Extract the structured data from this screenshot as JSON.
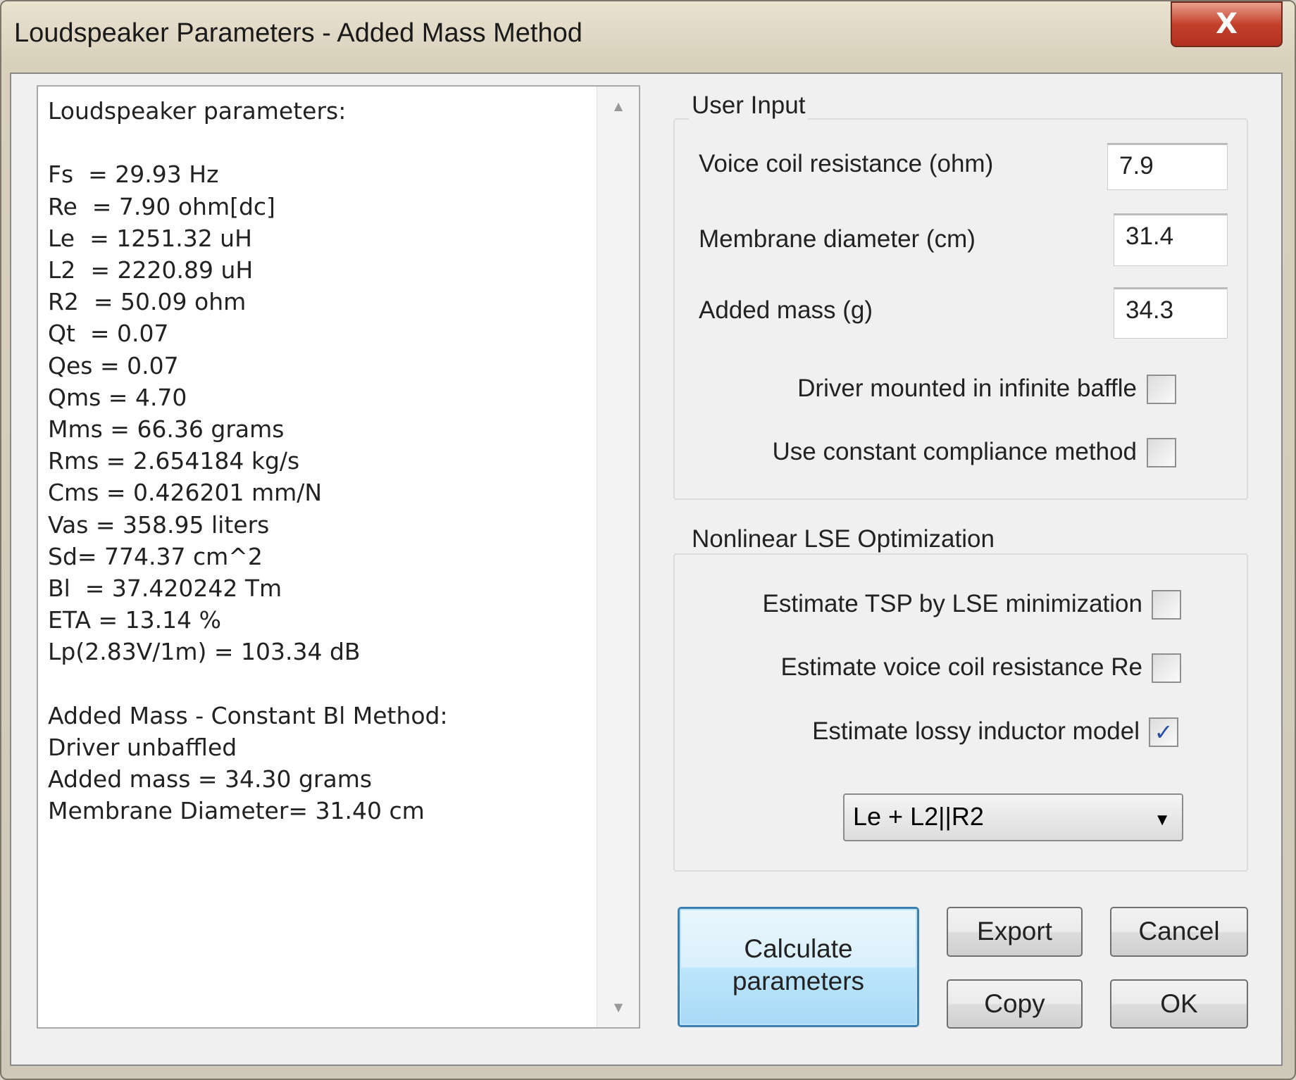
{
  "window": {
    "title": "Loudspeaker Parameters - Added Mass Method",
    "close_label": "X"
  },
  "results": {
    "lines": [
      "Loudspeaker parameters:",
      "",
      "Fs  = 29.93 Hz",
      "Re  = 7.90 ohm[dc]",
      "Le  = 1251.32 uH",
      "L2  = 2220.89 uH",
      "R2  = 50.09 ohm",
      "Qt  = 0.07",
      "Qes = 0.07",
      "Qms = 4.70",
      "Mms = 66.36 grams",
      "Rms = 2.654184 kg/s",
      "Cms = 0.426201 mm/N",
      "Vas = 358.95 liters",
      "Sd= 774.37 cm^2",
      "Bl  = 37.420242 Tm",
      "ETA = 13.14 %",
      "Lp(2.83V/1m) = 103.34 dB",
      "",
      "Added Mass - Constant Bl Method:",
      "Driver unbaffled",
      "Added mass = 34.30 grams",
      "Membrane Diameter= 31.40 cm"
    ]
  },
  "user_input": {
    "title": "User Input",
    "voice_coil_label": "Voice coil resistance (ohm)",
    "voice_coil_value": "7.9",
    "diameter_label": "Membrane diameter (cm)",
    "diameter_value": "31.4",
    "mass_label": "Added mass (g)",
    "mass_value": "34.3",
    "infinite_baffle_label": "Driver mounted in infinite baffle",
    "infinite_baffle_checked": false,
    "constant_compliance_label": "Use constant compliance method",
    "constant_compliance_checked": false
  },
  "lse": {
    "title": "Nonlinear LSE Optimization",
    "tsp_label": "Estimate TSP by LSE minimization",
    "tsp_checked": false,
    "re_label": "Estimate voice coil resistance Re",
    "re_checked": false,
    "lossy_label": "Estimate lossy inductor model",
    "lossy_checked": true,
    "model_selected": "Le + L2||R2"
  },
  "buttons": {
    "calculate": "Calculate\nparameters",
    "export": "Export",
    "cancel": "Cancel",
    "copy": "Copy",
    "ok": "OK"
  }
}
